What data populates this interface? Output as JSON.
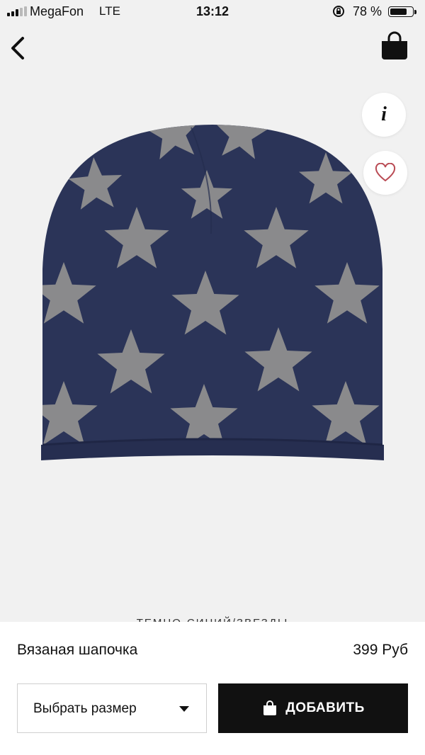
{
  "status_bar": {
    "carrier": "MegaFon",
    "network": "LTE",
    "time": "13:12",
    "battery_percent": "78 %",
    "battery_level": 0.78,
    "signal_bars": 5,
    "signal_active": 3
  },
  "nav": {
    "back_icon": "chevron-left-icon",
    "bag_icon": "shopping-bag-icon"
  },
  "actions": {
    "info_label": "i",
    "favorite_icon": "heart-icon"
  },
  "product": {
    "color_label": "ТЕМНО-СИНИЙ/ЗВЕЗДЫ",
    "name": "Вязаная шапочка",
    "price": "399 Руб",
    "image_subject": "knitted-beanie-navy-with-grey-stars"
  },
  "controls": {
    "size_select_label": "Выбрать размер",
    "add_button_label": "ДОБАВИТЬ"
  },
  "colors": {
    "hat_navy": "#2b3458",
    "star_grey": "#8a8a8c",
    "background": "#f1f1f1",
    "heart": "#b94a53"
  }
}
